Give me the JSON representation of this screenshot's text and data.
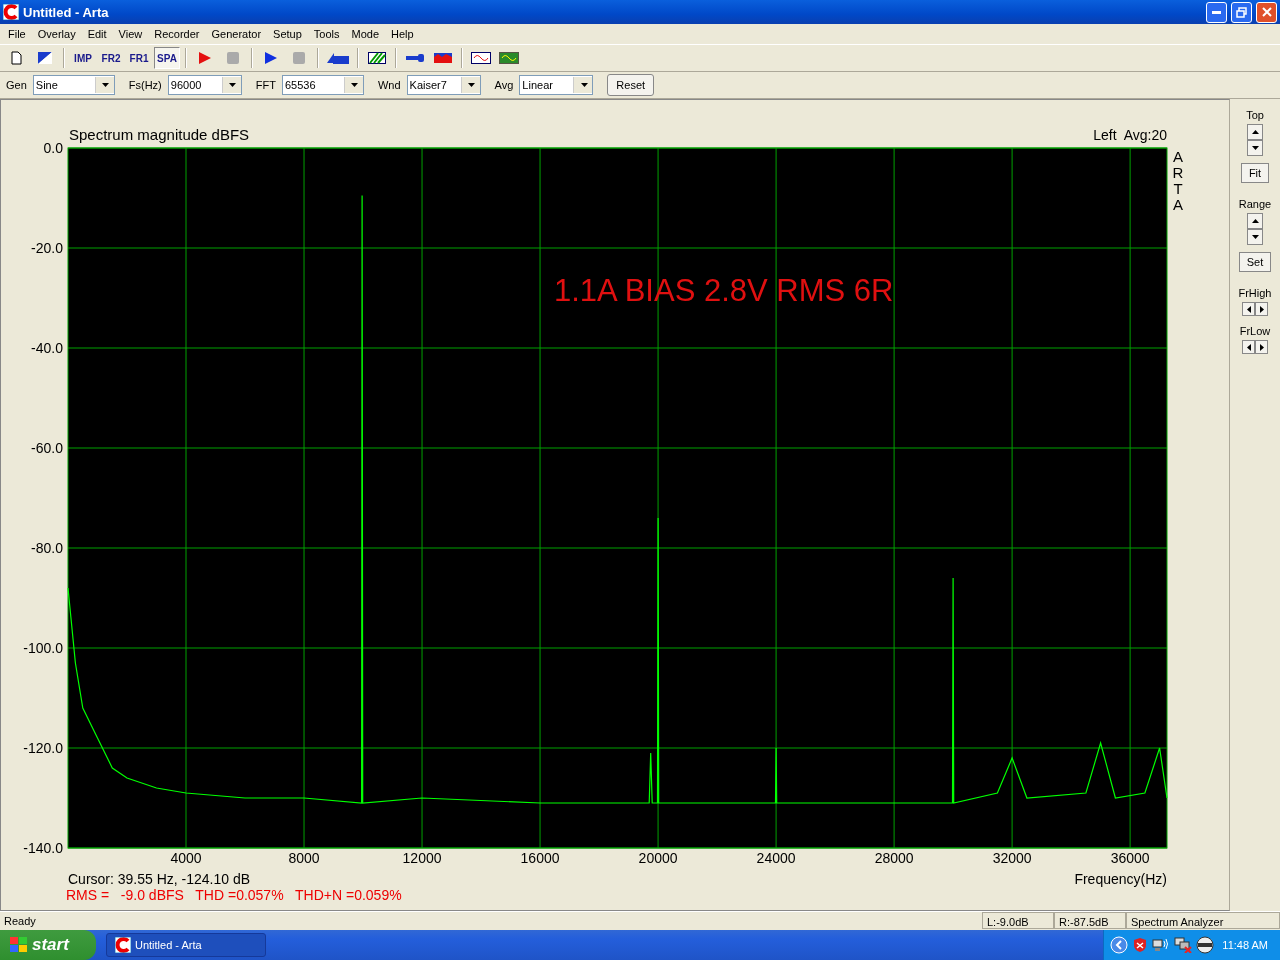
{
  "window": {
    "title": "Untitled - Arta"
  },
  "menu": [
    "File",
    "Overlay",
    "Edit",
    "View",
    "Recorder",
    "Generator",
    "Setup",
    "Tools",
    "Mode",
    "Help"
  ],
  "toolbar": [
    {
      "kind": "new"
    },
    {
      "kind": "open"
    },
    {
      "kind": "sep"
    },
    {
      "kind": "mode",
      "label": "IMP",
      "selected": false
    },
    {
      "kind": "mode",
      "label": "FR2",
      "selected": false
    },
    {
      "kind": "mode",
      "label": "FR1",
      "selected": false
    },
    {
      "kind": "mode",
      "label": "SPA",
      "selected": true
    },
    {
      "kind": "sep"
    },
    {
      "kind": "record"
    },
    {
      "kind": "stop"
    },
    {
      "kind": "sep"
    },
    {
      "kind": "play"
    },
    {
      "kind": "stop"
    },
    {
      "kind": "sep"
    },
    {
      "kind": "abc"
    },
    {
      "kind": "sep"
    },
    {
      "kind": "stripes"
    },
    {
      "kind": "sep"
    },
    {
      "kind": "probe"
    },
    {
      "kind": "meter"
    },
    {
      "kind": "sep"
    },
    {
      "kind": "scope"
    },
    {
      "kind": "greenscope"
    }
  ],
  "params": [
    {
      "label": "Gen",
      "value": "Sine"
    },
    {
      "label": "Fs(Hz)",
      "value": "96000"
    },
    {
      "label": "FFT",
      "value": "65536"
    },
    {
      "label": "Wnd",
      "value": "Kaiser7"
    },
    {
      "label": "Avg",
      "value": "Linear"
    }
  ],
  "reset_button": "Reset",
  "plot": {
    "channel_info": "Left  Avg:20",
    "brand": "ARTA",
    "chart_data": {
      "type": "line",
      "title": "Spectrum magnitude dBFS",
      "xlabel": "Frequency(Hz)",
      "xlim": [
        0,
        37250
      ],
      "ylim": [
        -140,
        0
      ],
      "xticks": [
        4000,
        8000,
        12000,
        16000,
        20000,
        24000,
        28000,
        32000,
        36000
      ],
      "yticks": [
        {
          "value": 0,
          "label": "0.0"
        },
        {
          "value": -20,
          "label": "-20.0"
        },
        {
          "value": -40,
          "label": "-40.0"
        },
        {
          "value": -60,
          "label": "-60.0"
        },
        {
          "value": -80,
          "label": "-80.0"
        },
        {
          "value": -100,
          "label": "-100.0"
        },
        {
          "value": -120,
          "label": "-120.0"
        },
        {
          "value": -140,
          "label": "-140.0"
        }
      ],
      "x": [
        0,
        250,
        500,
        1000,
        1500,
        2000,
        3000,
        4000,
        6000,
        8000,
        9950,
        9970,
        9990,
        12000,
        16000,
        19700,
        19750,
        19800,
        19980,
        20000,
        20020,
        23980,
        24000,
        24020,
        29980,
        30000,
        30020,
        31500,
        32000,
        32500,
        34500,
        35000,
        35500,
        36500,
        37000,
        37250
      ],
      "grid": true,
      "series": [
        {
          "color": "#00ff00",
          "values": [
            -88,
            -103,
            -112,
            -118,
            -124,
            -126,
            -128,
            -129,
            -130,
            -130,
            -131,
            -9.5,
            -131,
            -130,
            -131,
            -131,
            -121,
            -131,
            -131,
            -74,
            -131,
            -131,
            -120,
            -131,
            -131,
            -86,
            -131,
            -129,
            -122,
            -130,
            -129,
            -119,
            -130,
            -129,
            -120,
            -130
          ]
        }
      ],
      "annotations": [
        "1.1A BIAS 2.8V RMS 6R"
      ]
    },
    "cursor": "Cursor: 39.55 Hz, -124.10 dB",
    "measurements": "RMS =   -9.0 dBFS   THD =0.057%   THD+N =0.059%"
  },
  "side_panel": [
    {
      "kind": "vspin",
      "label": "Top"
    },
    {
      "kind": "button",
      "label": "Fit"
    },
    {
      "kind": "vspin",
      "label": "Range"
    },
    {
      "kind": "button",
      "label": "Set"
    },
    {
      "kind": "hspin",
      "label": "FrHigh"
    },
    {
      "kind": "hspin",
      "label": "FrLow"
    }
  ],
  "status_bar": [
    "Ready",
    "L:-9.0dB",
    "R:-87.5dB",
    "Spectrum Analyzer"
  ],
  "taskbar": {
    "start": "start",
    "task": "Untitled - Arta",
    "clock": "11:48 AM"
  }
}
